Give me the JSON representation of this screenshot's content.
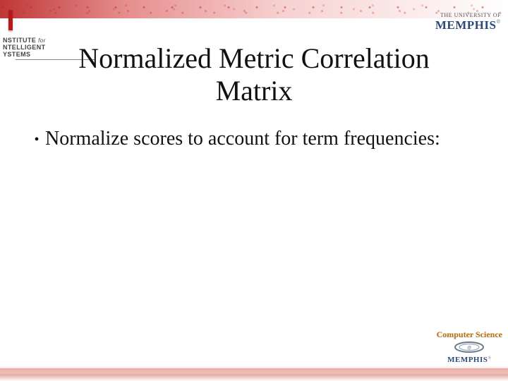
{
  "header": {
    "institute": {
      "line1_a": "NSTITUTE",
      "line1_b": "for",
      "line2": "NTELLIGENT",
      "line3": "YSTEMS"
    },
    "university": {
      "prefix": "THE UNIVERSITY OF",
      "name": "MEMPHIS",
      "registered": "®"
    }
  },
  "title": "Normalized Metric Correlation Matrix",
  "bullets": [
    "Normalize scores to account for term frequencies:"
  ],
  "footer": {
    "dept": "Computer Science",
    "university": "MEMPHIS",
    "registered": "®"
  }
}
